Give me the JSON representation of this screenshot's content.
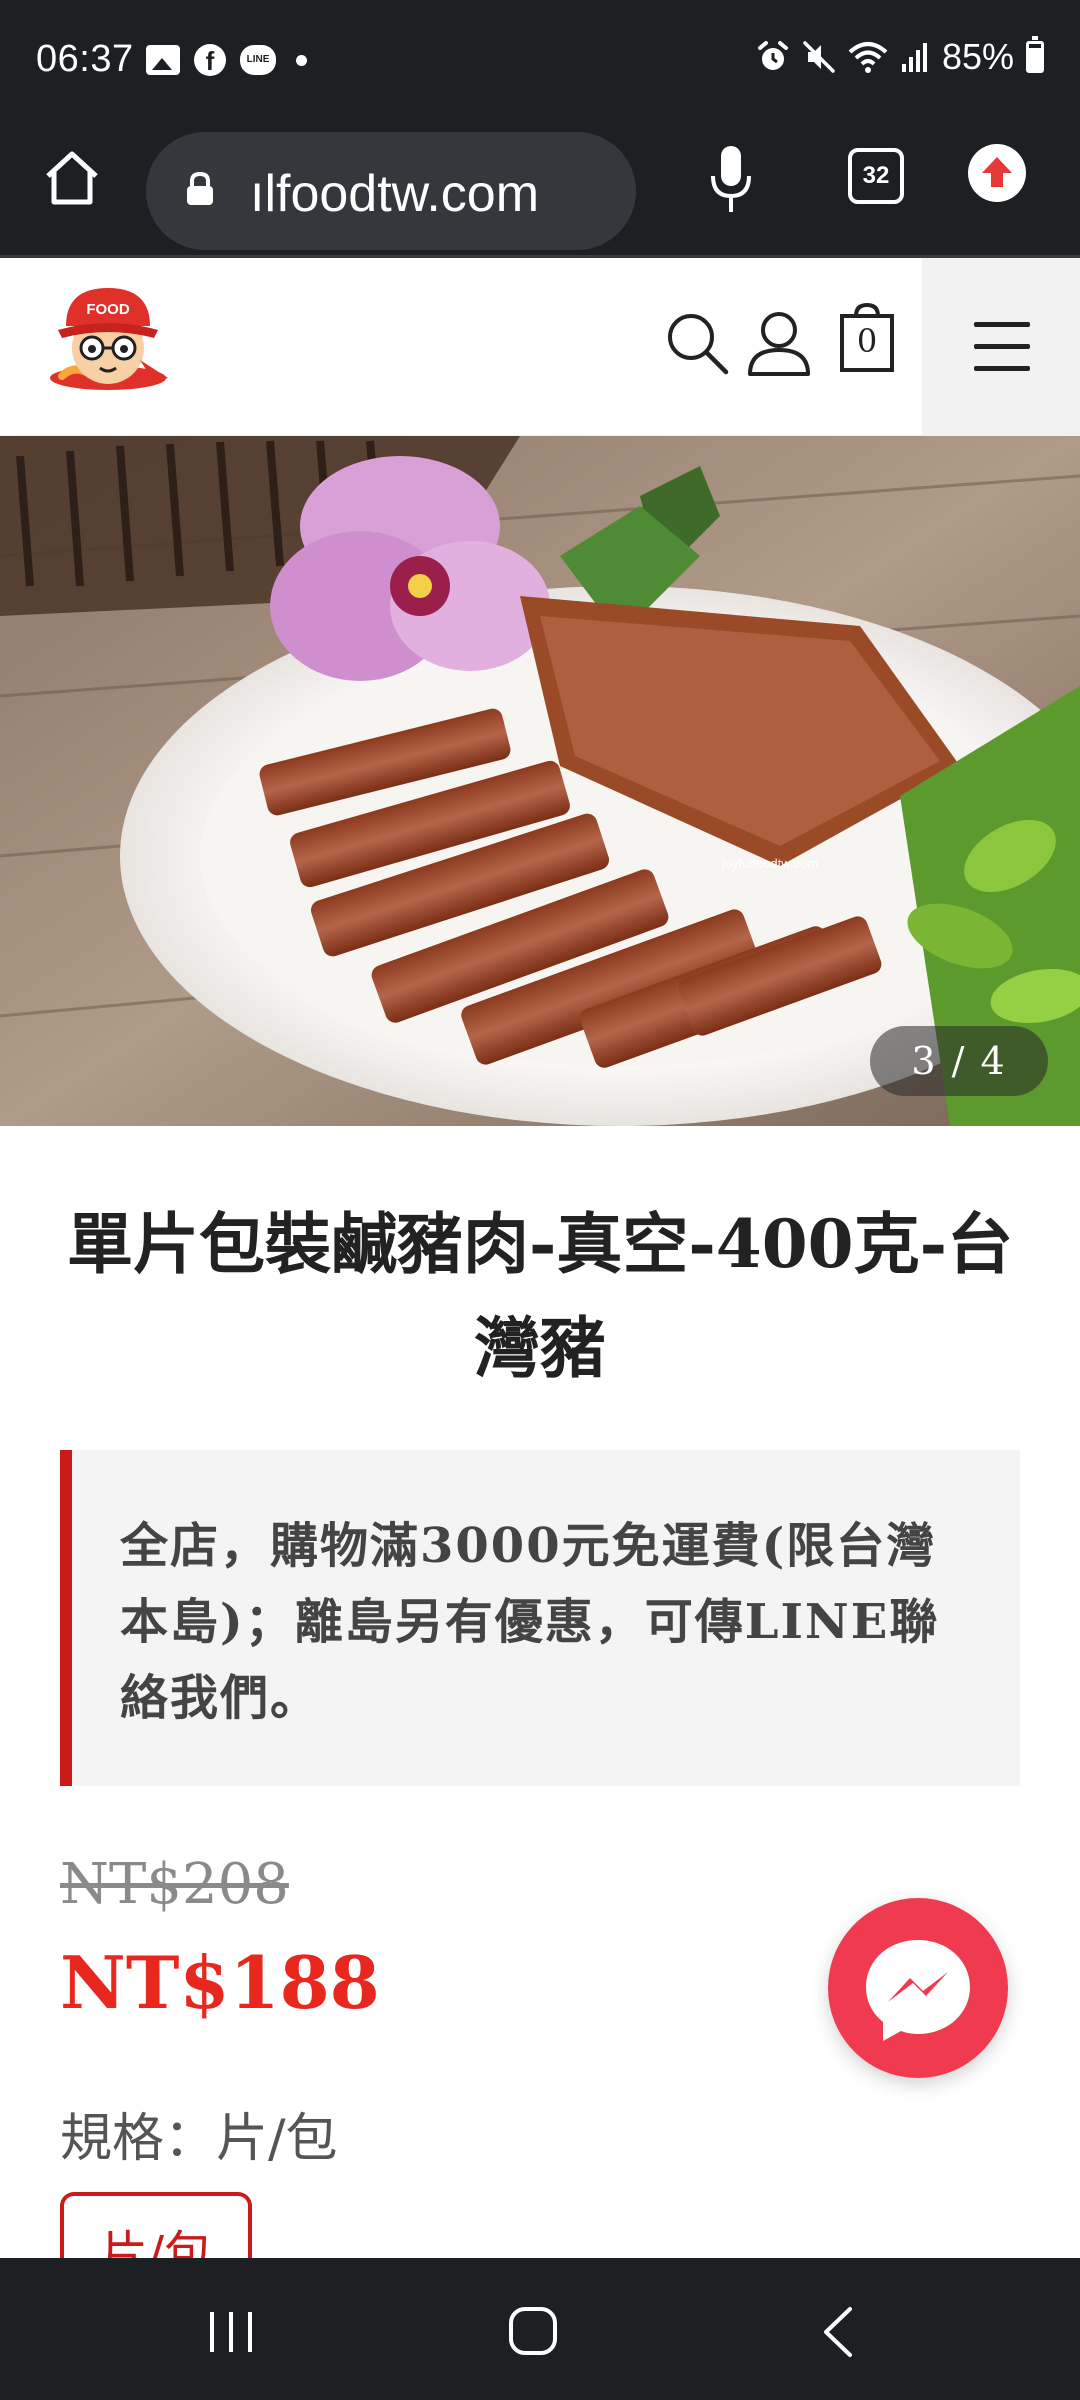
{
  "status_bar": {
    "time": "06:37",
    "facebook_glyph": "f",
    "line_badge": "LINE",
    "battery": "85%",
    "icons": [
      "gallery-icon",
      "facebook-icon",
      "line-icon",
      "alarm-icon",
      "mute-icon",
      "wifi-icon",
      "signal-icon",
      "battery-icon"
    ]
  },
  "browser": {
    "url": "ılfoodtw.com",
    "tab_count": "32",
    "icons": [
      "home-icon",
      "lock-icon",
      "mic-icon",
      "tabs-icon",
      "update-icon"
    ]
  },
  "site_header": {
    "logo_text": "FOOD",
    "cart_count": "0",
    "icons": [
      "search-icon",
      "user-icon",
      "cart-icon",
      "hamburger-menu-icon"
    ]
  },
  "gallery": {
    "counter": "3 / 4",
    "watermark": "joyfulfoodtw.com"
  },
  "product": {
    "title": "單片包裝鹹豬肉-真空-400克-台灣豬",
    "notice": "全店，購物滿3000元免運費(限台灣本島)；離島另有優惠，可傳LINE聯絡我們。",
    "price_original": "NT$208",
    "price_sale": "NT$188",
    "spec_label": "規格：片/包",
    "spec_options": [
      "片/包"
    ]
  },
  "colors": {
    "accent_red": "#cc1a1a",
    "sale_price": "#e8281e",
    "messenger": "#f03a4f",
    "system_bar": "#1d2023"
  }
}
